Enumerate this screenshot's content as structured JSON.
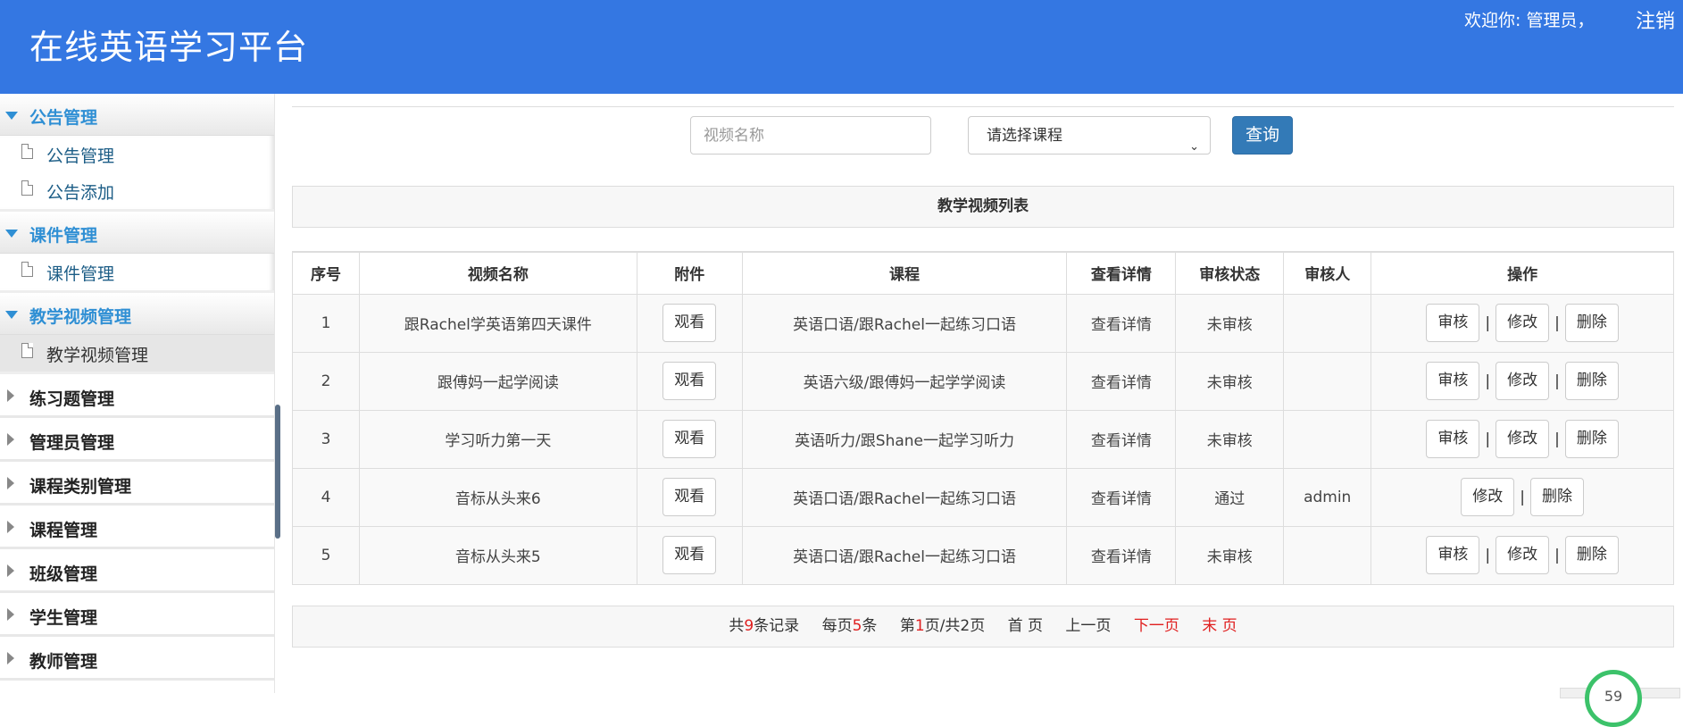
{
  "header": {
    "title": "在线英语学习平台",
    "welcome": "欢迎你: 管理员，",
    "logout": "注销",
    "bg_color": "#3477e2"
  },
  "sidebar": {
    "groups_open": [
      {
        "label": "公告管理",
        "items": [
          {
            "label": "公告管理"
          },
          {
            "label": "公告添加"
          }
        ]
      },
      {
        "label": "课件管理",
        "items": [
          {
            "label": "课件管理"
          }
        ]
      },
      {
        "label": "教学视频管理",
        "items": [
          {
            "label": "教学视频管理",
            "active": true
          }
        ]
      }
    ],
    "groups_closed": [
      {
        "label": "练习题管理"
      },
      {
        "label": "管理员管理"
      },
      {
        "label": "课程类别管理"
      },
      {
        "label": "课程管理"
      },
      {
        "label": "班级管理"
      },
      {
        "label": "学生管理"
      },
      {
        "label": "教师管理"
      }
    ]
  },
  "search": {
    "placeholder": "视频名称",
    "select_value": "请选择课程",
    "query_label": "查询"
  },
  "list_title": "教学视频列表",
  "table": {
    "headers": [
      "序号",
      "视频名称",
      "附件",
      "课程",
      "查看详情",
      "审核状态",
      "审核人",
      "操作"
    ],
    "rows": [
      {
        "no": "1",
        "name": "跟Rachel学英语第四天课件",
        "attach": "观看",
        "course": "英语口语/跟Rachel一起练习口语",
        "detail": "查看详情",
        "status": "未审核",
        "reviewer": "",
        "actions": [
          "审核",
          "修改",
          "删除"
        ]
      },
      {
        "no": "2",
        "name": "跟傅妈一起学阅读",
        "attach": "观看",
        "course": "英语六级/跟傅妈一起学学阅读",
        "detail": "查看详情",
        "status": "未审核",
        "reviewer": "",
        "actions": [
          "审核",
          "修改",
          "删除"
        ]
      },
      {
        "no": "3",
        "name": "学习听力第一天",
        "attach": "观看",
        "course": "英语听力/跟Shane一起学习听力",
        "detail": "查看详情",
        "status": "未审核",
        "reviewer": "",
        "actions": [
          "审核",
          "修改",
          "删除"
        ]
      },
      {
        "no": "4",
        "name": "音标从头来6",
        "attach": "观看",
        "course": "英语口语/跟Rachel一起练习口语",
        "detail": "查看详情",
        "status": "通过",
        "reviewer": "admin",
        "actions": [
          "修改",
          "删除"
        ]
      },
      {
        "no": "5",
        "name": "音标从头来5",
        "attach": "观看",
        "course": "英语口语/跟Rachel一起练习口语",
        "detail": "查看详情",
        "status": "未审核",
        "reviewer": "",
        "actions": [
          "审核",
          "修改",
          "删除"
        ]
      }
    ]
  },
  "pager": {
    "total_prefix": "共",
    "total": "9",
    "total_suffix": "条记录",
    "per_prefix": "每页",
    "per": "5",
    "per_suffix": "条",
    "page_prefix": "第",
    "page": "1",
    "page_suffix": "页/共2页",
    "first": "首 页",
    "prev": "上一页",
    "next": "下一页",
    "last": "末 页"
  },
  "widget": {
    "value": "59"
  }
}
